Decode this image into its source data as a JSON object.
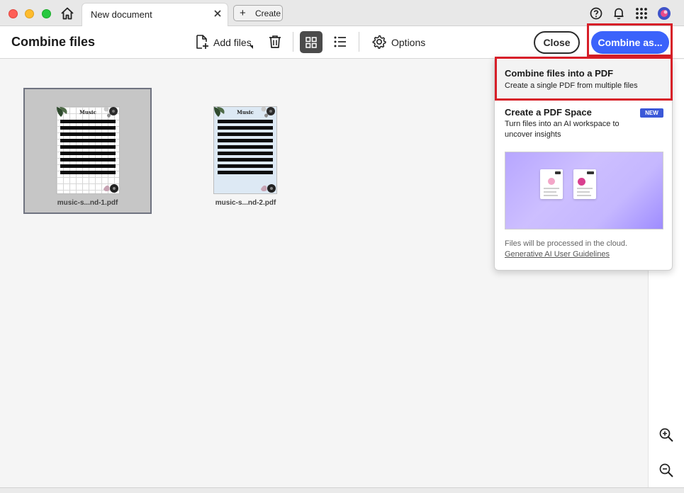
{
  "titlebar": {
    "tab_title": "New document",
    "create_label": "Create",
    "icons": [
      "home-icon",
      "close-icon",
      "plus-icon",
      "help-icon",
      "bell-icon",
      "apps-grid-icon",
      "avatar"
    ]
  },
  "toolbar": {
    "page_title": "Combine files",
    "add_files_label": "Add files",
    "options_label": "Options",
    "close_label": "Close",
    "combine_label": "Combine as...",
    "accent_color": "#3b63fb",
    "highlight_color": "#d71e28"
  },
  "files": [
    {
      "name": "music-s...nd-1.pdf",
      "thumb_title": "Music",
      "selected": true
    },
    {
      "name": "music-s...nd-2.pdf",
      "thumb_title": "Music",
      "selected": false
    }
  ],
  "dropdown": {
    "option1_title": "Combine files into a PDF",
    "option1_desc": "Create a single PDF from multiple files",
    "option2_title": "Create a PDF Space",
    "option2_badge": "NEW",
    "option2_desc_line1": "Turn files into an AI workspace to",
    "option2_desc_line2": "uncover insights",
    "cloud_note": "Files will be processed in the cloud.",
    "guidelines_link": "Generative AI User Guidelines"
  }
}
